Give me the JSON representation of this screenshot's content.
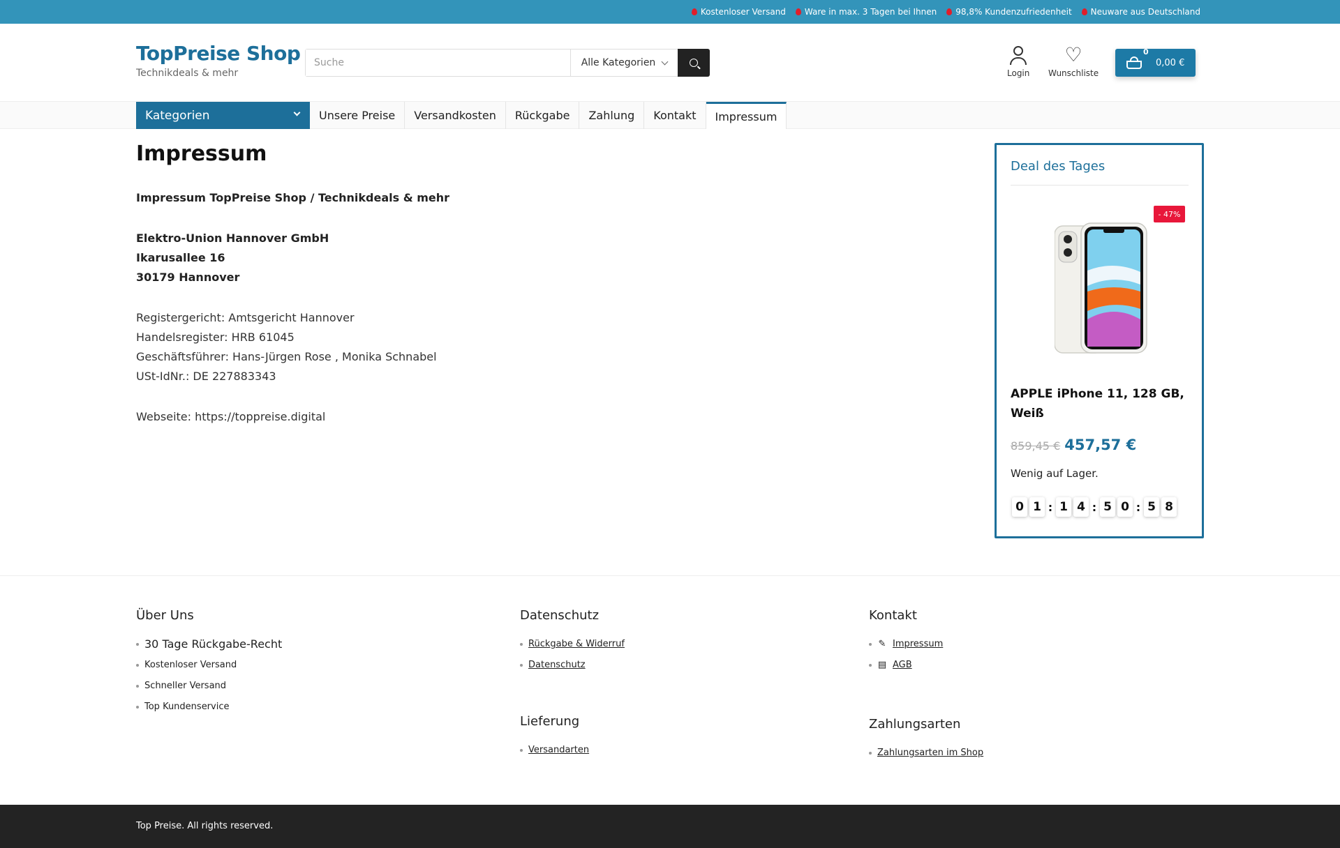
{
  "topbar": {
    "items": [
      "Kostenloser Versand",
      "Ware in max. 3 Tagen bei Ihnen",
      "98,8% Kundenzufriedenheit",
      "Neuware aus Deutschland"
    ]
  },
  "header": {
    "logo_title": "TopPreise Shop",
    "logo_subtitle": "Technikdeals & mehr",
    "search_placeholder": "Suche",
    "search_category": "Alle Kategorien",
    "login_label": "Login",
    "wishlist_label": "Wunschliste",
    "cart_count": "0",
    "cart_total": "0,00 €"
  },
  "nav": {
    "categories_label": "Kategorien",
    "links": [
      "Unsere Preise",
      "Versandkosten",
      "Rückgabe",
      "Zahlung",
      "Kontakt",
      "Impressum"
    ]
  },
  "main": {
    "title": "Impressum",
    "heading": "Impressum TopPreise Shop / Technikdeals & mehr",
    "company": "Elektro-Union Hannover GmbH",
    "street": "Ikarusallee 16",
    "city": "30179 Hannover",
    "register_court": "Registergericht: Amtsgericht Hannover",
    "trade_register": "Handelsregister: HRB 61045",
    "managers": "Geschäftsführer: Hans-Jürgen Rose , Monika Schnabel",
    "vat_id": "USt-IdNr.: DE 227883343",
    "website": "Webseite: https://toppreise.digital"
  },
  "deal": {
    "title": "Deal des Tages",
    "badge": "- 47%",
    "product_name": "APPLE iPhone 11, 128 GB, Weiß",
    "old_price": "859,45 €",
    "new_price": "457,57 €",
    "stock": "Wenig auf Lager.",
    "timer": [
      "0",
      "1",
      "1",
      "4",
      "5",
      "0",
      "5",
      "8"
    ]
  },
  "footer": {
    "about": {
      "title": "Über Uns",
      "items": [
        "30 Tage Rückgabe-Recht",
        "Kostenloser Versand",
        "Schneller Versand",
        "Top Kundenservice"
      ]
    },
    "privacy": {
      "title": "Datenschutz",
      "items": [
        "Rückgabe & Widerruf",
        "Datenschutz"
      ]
    },
    "delivery": {
      "title": "Lieferung",
      "items": [
        "Versandarten"
      ]
    },
    "contact": {
      "title": "Kontakt",
      "items": [
        "Impressum",
        "AGB"
      ]
    },
    "payment": {
      "title": "Zahlungsarten",
      "items": [
        "Zahlungsarten im Shop"
      ]
    },
    "copyright": "Top Preise. All rights reserved."
  }
}
